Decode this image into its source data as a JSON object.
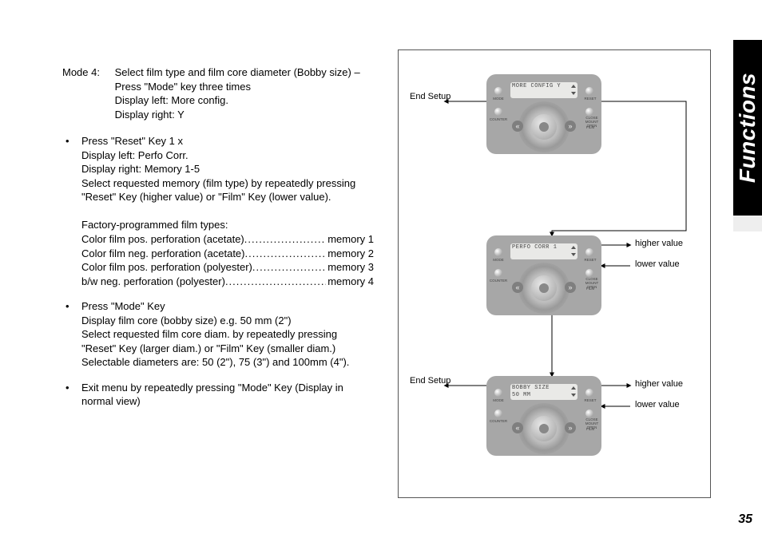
{
  "side_tab": "Functions",
  "page_number": "35",
  "text": {
    "mode4_label": "Mode 4:",
    "mode4_line1": "Select film type and film core diameter (Bobby size) – Press \"Mode\" key three times",
    "mode4_line2": "Display left: More config.",
    "mode4_line3": "Display right: Y",
    "b1_line1": "Press \"Reset\" Key 1 x",
    "b1_line2": "Display left: Perfo Corr.",
    "b1_line3": "Display right: Memory 1-5",
    "b1_line4": "Select requested memory (film type) by repeatedly pressing \"Reset\" Key (higher value) or \"Film\" Key (lower value).",
    "b1_fact_hdr": "Factory-programmed film types:",
    "films": [
      {
        "label": "Color film pos. perforation (acetate)",
        "mem": "memory 1"
      },
      {
        "label": "Color film neg. perforation (acetate)",
        "mem": "memory 2"
      },
      {
        "label": "Color film pos. perforation (polyester)",
        "mem": "memory 3"
      },
      {
        "label": "b/w neg. perforation (polyester)",
        "mem": "memory 4"
      }
    ],
    "b2_line1": "Press \"Mode\" Key",
    "b2_line2": "Display film core (bobby size) e.g. 50 mm (2\")",
    "b2_line3": "Select requested film core diam. by repeatedly pressing \"Reset\" Key (larger diam.) or \"Film\" Key (smaller diam.) Selectable diameters are: 50 (2\"), 75 (3\") and 100mm (4\").",
    "b3": "Exit menu by repeatedly pressing \"Mode\" Key (Display in normal view)"
  },
  "diagram": {
    "end_setup": "End Setup",
    "higher_value": "higher value",
    "lower_value": "lower value",
    "panel_btns": {
      "mode": "MODE",
      "reset": "RESET",
      "counter": "COUNTER",
      "close_mount_open": "CLOSE\nMOUNT\nOPEN",
      "film": "FILM"
    },
    "p1": {
      "line1": "MORE CONFIG  Y",
      "line2": ""
    },
    "p2": {
      "line1": "PERFO CORR 1",
      "line2": ""
    },
    "p3": {
      "line1": "BOBBY SIZE",
      "line2": "50 MM"
    }
  }
}
